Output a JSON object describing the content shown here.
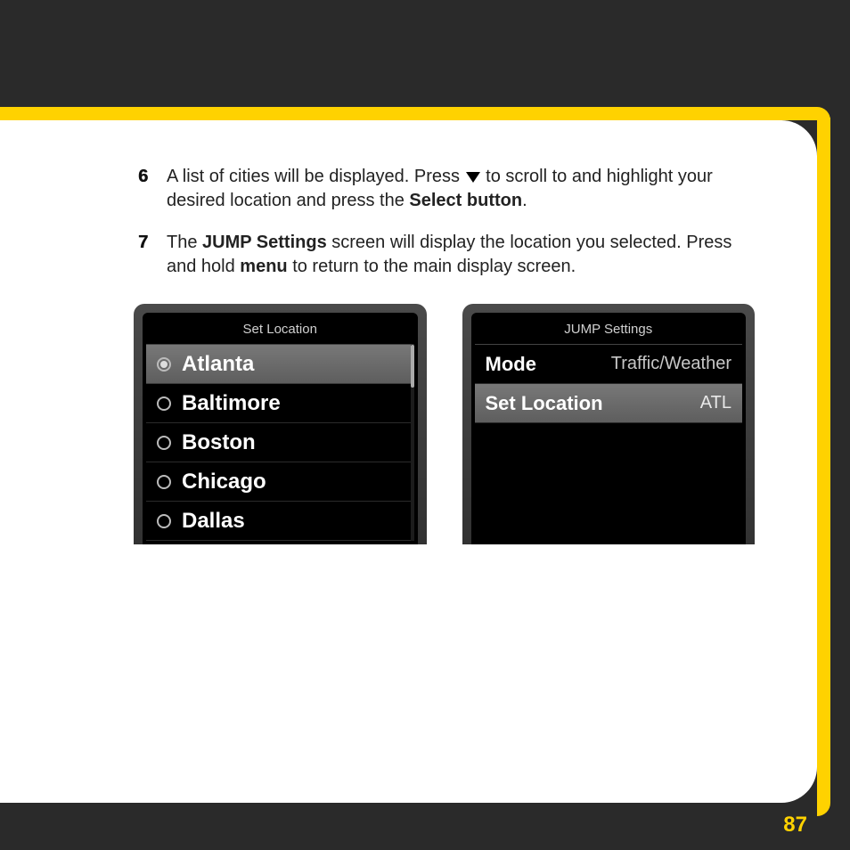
{
  "steps": [
    {
      "num": "6",
      "pre": "A list of cities will be displayed. Press ",
      "post_icon": " to scroll to and highlight your desired location and press the ",
      "bold1": "Select button",
      "tail": "."
    },
    {
      "num": "7",
      "pre": "The ",
      "bold1": "JUMP Settings",
      "mid": " screen will display the location you selected. Press and hold ",
      "bold2": "menu",
      "tail": " to return to the main display screen."
    }
  ],
  "screen_left": {
    "title": "Set Location",
    "items": [
      {
        "label": "Atlanta",
        "selected": true
      },
      {
        "label": "Baltimore",
        "selected": false
      },
      {
        "label": "Boston",
        "selected": false
      },
      {
        "label": "Chicago",
        "selected": false
      },
      {
        "label": "Dallas",
        "selected": false
      }
    ]
  },
  "screen_right": {
    "title": "JUMP Settings",
    "rows": [
      {
        "label": "Mode",
        "value": "Traffic/Weather",
        "selected": false
      },
      {
        "label": "Set Location",
        "value": "ATL",
        "selected": true
      }
    ]
  },
  "page_number": "87"
}
